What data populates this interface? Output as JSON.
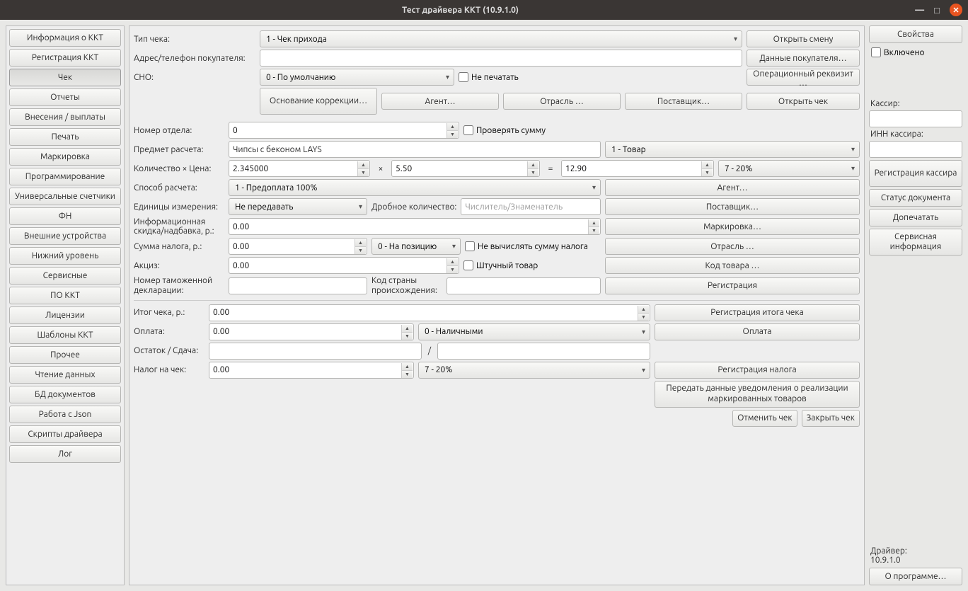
{
  "window": {
    "title": "Тест драйвера ККТ (10.9.1.0)"
  },
  "left_buttons": [
    "Информация о ККТ",
    "Регистрация ККТ",
    "Чек",
    "Отчеты",
    "Внесения / выплаты",
    "Печать",
    "Маркировка",
    "Программирование",
    "Универсальные счетчики",
    "ФН",
    "Внешние устройства",
    "Нижний уровень",
    "Сервисные",
    "ПО ККТ",
    "Лицензии",
    "Шаблоны ККТ",
    "Прочее",
    "Чтение данных",
    "БД документов",
    "Работа с Json",
    "Скрипты драйвера",
    "Лог"
  ],
  "right": {
    "properties": "Свойства",
    "enabled": "Включено",
    "cashier_label": "Кассир:",
    "cashier_inn_label": "ИНН кассира:",
    "cashier_value": "",
    "cashier_inn_value": "",
    "register_cashier": "Регистрация кассира",
    "doc_status": "Статус документа",
    "reprint": "Допечатать",
    "service_info": "Сервисная информация",
    "driver_label": "Драйвер:",
    "driver_version": "10.9.1.0",
    "about": "О программе…"
  },
  "main": {
    "check_type_label": "Тип чека:",
    "check_type_value": "1 - Чек прихода",
    "open_shift": "Открыть смену",
    "address_label": "Адрес/телефон покупателя:",
    "address_value": "",
    "buyer_data": "Данные покупателя…",
    "sno_label": "СНО:",
    "sno_value": "0 - По умолчанию",
    "dont_print": "Не печатать",
    "op_requisite": "Операционный реквизит …",
    "correction_basis": "Основание коррекции…",
    "agent": "Агент…",
    "branch": "Отрасль …",
    "supplier": "Поставщик…",
    "open_check": "Открыть чек",
    "dept_label": "Номер отдела:",
    "dept_value": "0",
    "verify_sum": "Проверять сумму",
    "subject_label": "Предмет расчета:",
    "subject_value": "Чипсы с беконом LAYS",
    "subject_type": "1 - Товар",
    "qty_price_label": "Количество × Цена:",
    "qty_value": "2.345000",
    "mult": "×",
    "price_value": "5.50",
    "eq": "=",
    "total_value": "12.90",
    "tax_rate": "7 - 20%",
    "pay_method_label": "Способ расчета:",
    "pay_method_value": "1 - Предоплата 100%",
    "agent2": "Агент…",
    "units_label": "Единицы измерения:",
    "units_value": "Не передавать",
    "frac_qty_label": "Дробное количество:",
    "frac_qty_placeholder": "Числитель/Знаменатель",
    "supplier2": "Поставщик…",
    "info_discount_label": "Информационная скидка/надбавка, р.:",
    "info_discount_value": "0.00",
    "marking": "Маркировка…",
    "tax_sum_label": "Сумма налога, р.:",
    "tax_sum_value": "0.00",
    "tax_mode": "0 - На позицию",
    "no_calc_tax": "Не вычислять сумму налога",
    "branch2": "Отрасль …",
    "excise_label": "Акциз:",
    "excise_value": "0.00",
    "piece_goods": "Штучный товар",
    "product_code": "Код товара …",
    "customs_label": "Номер таможенной декларации:",
    "customs_value": "",
    "country_label": "Код страны происхождения:",
    "country_value": "",
    "registration": "Регистрация",
    "total_label": "Итог чека, р.:",
    "total_check_value": "0.00",
    "register_total": "Регистрация итога чека",
    "payment_label": "Оплата:",
    "payment_value": "0.00",
    "payment_type": "0 - Наличными",
    "pay_btn": "Оплата",
    "change_label": "Остаток / Сдача:",
    "change_left": "",
    "change_right": "",
    "slash": "/",
    "check_tax_label": "Налог на чек:",
    "check_tax_value": "0.00",
    "check_tax_rate": "7 - 20%",
    "register_tax": "Регистрация налога",
    "send_marking": "Передать данные уведомления о реализации маркированных товаров",
    "cancel_check": "Отменить чек",
    "close_check": "Закрыть чек"
  }
}
